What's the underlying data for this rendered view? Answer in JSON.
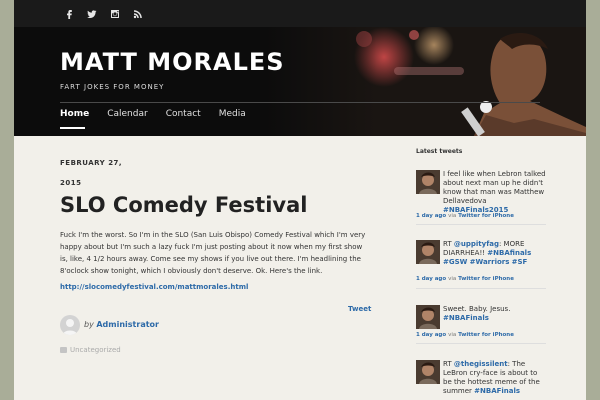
{
  "social": [
    "facebook-icon",
    "twitter-icon",
    "instagram-icon",
    "rss-icon"
  ],
  "site": {
    "title": "MATT MORALES",
    "tagline": "FART JOKES FOR MONEY"
  },
  "nav": [
    "Home",
    "Calendar",
    "Contact",
    "Media"
  ],
  "post": {
    "date_line1": "FEBRUARY 27,",
    "date_line2": "2015",
    "title": "SLO Comedy Festival",
    "body": "Fuck I'm the worst. So I'm in the SLO (San Luis Obispo) Comedy Festival which I'm very happy about but I'm such a lazy fuck I'm just posting about it now when my first show is, like, 4 1/2 hours away. Come see my shows if you live out there. I'm headlining the 8'oclock show tonight, which I obviously don't deserve. Ok. Here's the link.",
    "link": "http://slocomedyfestival.com/mattmorales.html",
    "tweet_label": "Tweet",
    "by": "by",
    "author": "Administrator",
    "category": "Uncategorized"
  },
  "sidebar": {
    "title": "Latest tweets",
    "tweets": [
      {
        "text": "I feel like when Lebron talked about next man up he didn't know that man was Matthew Dellavedova",
        "tag": "#NBAFinals2015",
        "time": "1 day ago",
        "via": "via",
        "source": "Twitter for iPhone"
      },
      {
        "text_a": "RT",
        "mention": "@uppityfag",
        "text_b": ": MORE DIARRHEA!!",
        "tag1": "#NBAfinals",
        "tag2": "#GSW",
        "tag3": "#Warriors",
        "tag4": "#SF",
        "time": "1 day ago",
        "via": "via",
        "source": "Twitter for iPhone"
      },
      {
        "text": "Sweet. Baby. Jesus.",
        "tag": "#NBAFinals",
        "time": "1 day ago",
        "via": "via",
        "source": "Twitter for iPhone"
      },
      {
        "text_a": "RT",
        "mention": "@thegissilent",
        "text_b": ": The LeBron cry-face is about to be the hottest meme of the summer",
        "tag": "#NBAFinals"
      }
    ]
  }
}
